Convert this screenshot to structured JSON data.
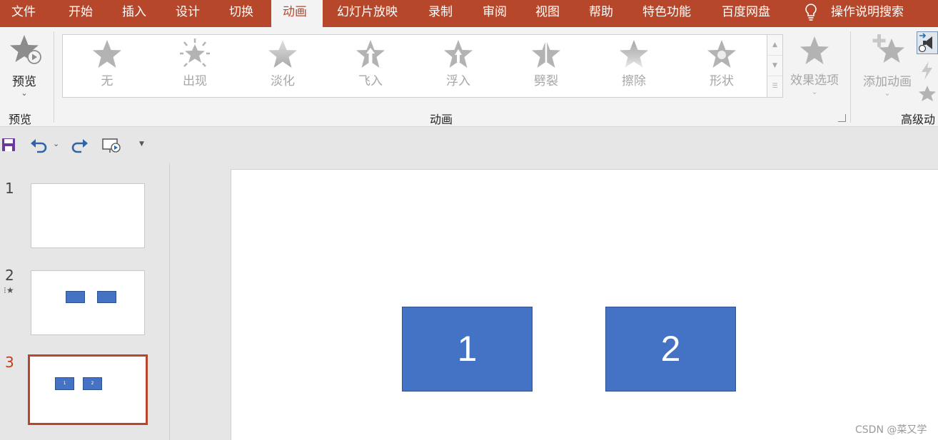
{
  "tabs": [
    {
      "label": "文件"
    },
    {
      "label": "开始"
    },
    {
      "label": "插入"
    },
    {
      "label": "设计"
    },
    {
      "label": "切换"
    },
    {
      "label": "动画"
    },
    {
      "label": "幻灯片放映"
    },
    {
      "label": "录制"
    },
    {
      "label": "审阅"
    },
    {
      "label": "视图"
    },
    {
      "label": "帮助"
    },
    {
      "label": "特色功能"
    },
    {
      "label": "百度网盘"
    }
  ],
  "active_tab": "动画",
  "tell_me": "操作说明搜索",
  "ribbon": {
    "preview_button": "预览",
    "preview_group": "预览",
    "animation_group": "动画",
    "advanced_group": "高级动",
    "effect_options": "效果选项",
    "add_animation": "添加动画",
    "gallery": [
      {
        "label": "无"
      },
      {
        "label": "出现"
      },
      {
        "label": "淡化"
      },
      {
        "label": "飞入"
      },
      {
        "label": "浮入"
      },
      {
        "label": "劈裂"
      },
      {
        "label": "擦除"
      },
      {
        "label": "形状"
      }
    ]
  },
  "slides": [
    {
      "number": "1"
    },
    {
      "number": "2"
    },
    {
      "number": "3"
    }
  ],
  "thumb3_boxes": [
    "1",
    "2"
  ],
  "canvas_shapes": [
    "1",
    "2"
  ],
  "watermark": "CSDN @菜又学",
  "colors": {
    "accent": "#b7472a",
    "shape_fill": "#4472c4",
    "shape_border": "#2f528f"
  }
}
